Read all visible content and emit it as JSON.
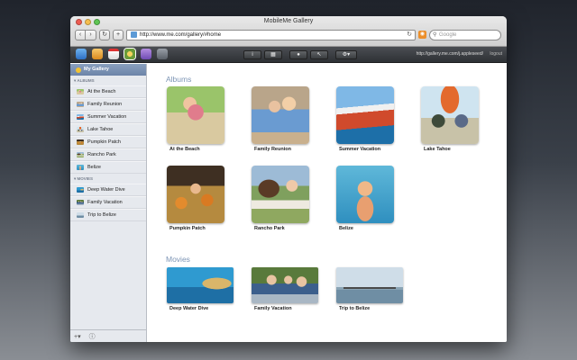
{
  "window": {
    "title": "MobileMe Gallery",
    "url": "http://www.me.com/gallery/#home",
    "search_placeholder": "Google"
  },
  "apptoolbar": {
    "account": "http://gallery.me.com/j.appleseed/",
    "logout": "logout"
  },
  "sidebar": {
    "my_gallery": "My Gallery",
    "albums_header": "ALBUMS",
    "movies_header": "MOVIES",
    "albums": [
      {
        "label": "At the Beach"
      },
      {
        "label": "Family Reunion"
      },
      {
        "label": "Summer Vacation"
      },
      {
        "label": "Lake Tahoe"
      },
      {
        "label": "Pumpkin Patch"
      },
      {
        "label": "Rancho Park"
      },
      {
        "label": "Belize"
      }
    ],
    "movies": [
      {
        "label": "Deep Water Dive"
      },
      {
        "label": "Family Vacation"
      },
      {
        "label": "Trip to Belize"
      }
    ]
  },
  "main": {
    "albums_title": "Albums",
    "movies_title": "Movies",
    "albums": [
      {
        "caption": "At the Beach"
      },
      {
        "caption": "Family Reunion"
      },
      {
        "caption": "Summer Vacation"
      },
      {
        "caption": "Lake Tahoe"
      },
      {
        "caption": "Pumpkin Patch"
      },
      {
        "caption": "Rancho Park"
      },
      {
        "caption": "Belize"
      }
    ],
    "movies": [
      {
        "caption": "Deep Water Dive"
      },
      {
        "caption": "Family Vacation"
      },
      {
        "caption": "Trip to Belize"
      }
    ]
  },
  "colors": {
    "accent": "#7d95b5",
    "sidebar_bg": "#e6e9ee",
    "toolbar_bg": "#3a3d41"
  }
}
